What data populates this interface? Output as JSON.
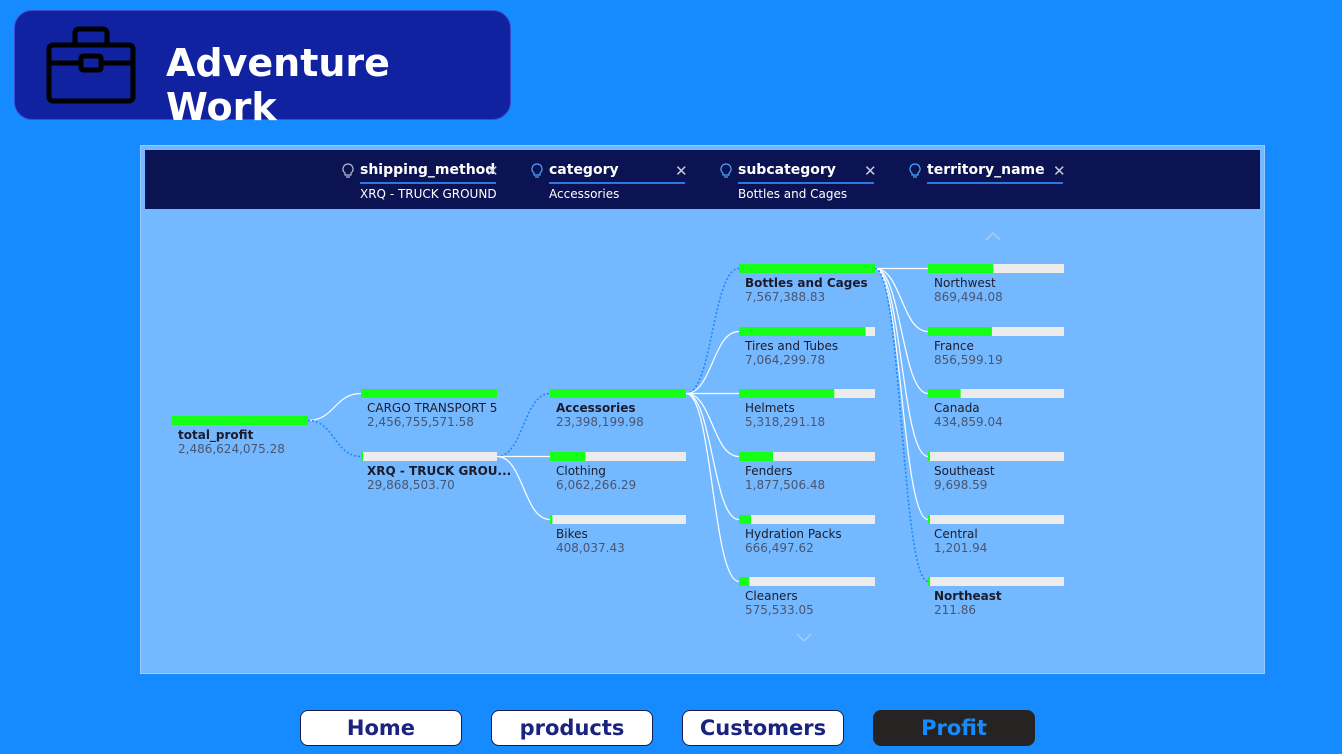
{
  "app": {
    "title": "Adventure Work"
  },
  "filters": [
    {
      "label": "shipping_method",
      "value": "XRQ - TRUCK GROUND"
    },
    {
      "label": "category",
      "value": "Accessories"
    },
    {
      "label": "subcategory",
      "value": "Bottles and Cages"
    },
    {
      "label": "territory_name",
      "value": ""
    }
  ],
  "tree": {
    "root": {
      "name": "total_profit",
      "value": "2,486,624,075.28",
      "fill": 1.0
    },
    "levels": [
      [
        {
          "name": "CARGO TRANSPORT 5",
          "value": "2,456,755,571.58",
          "fill": 1.0,
          "selected": false
        },
        {
          "name": "XRQ - TRUCK GROU...",
          "value": "29,868,503.70",
          "fill": 0.012,
          "selected": true
        }
      ],
      [
        {
          "name": "Accessories",
          "value": "23,398,199.98",
          "fill": 1.0,
          "selected": true
        },
        {
          "name": "Clothing",
          "value": "6,062,266.29",
          "fill": 0.26,
          "selected": false
        },
        {
          "name": "Bikes",
          "value": "408,037.43",
          "fill": 0.017,
          "selected": false
        }
      ],
      [
        {
          "name": "Bottles and Cages",
          "value": "7,567,388.83",
          "fill": 1.0,
          "selected": true
        },
        {
          "name": "Tires and Tubes",
          "value": "7,064,299.78",
          "fill": 0.93,
          "selected": false
        },
        {
          "name": "Helmets",
          "value": "5,318,291.18",
          "fill": 0.7,
          "selected": false
        },
        {
          "name": "Fenders",
          "value": "1,877,506.48",
          "fill": 0.25,
          "selected": false
        },
        {
          "name": "Hydration Packs",
          "value": "666,497.62",
          "fill": 0.088,
          "selected": false
        },
        {
          "name": "Cleaners",
          "value": "575,533.05",
          "fill": 0.076,
          "selected": false
        }
      ],
      [
        {
          "name": "Northwest",
          "value": "869,494.08",
          "fill": 0.48,
          "selected": false
        },
        {
          "name": "France",
          "value": "856,599.19",
          "fill": 0.47,
          "selected": false
        },
        {
          "name": "Canada",
          "value": "434,859.04",
          "fill": 0.24,
          "selected": false
        },
        {
          "name": "Southeast",
          "value": "9,698.59",
          "fill": 0.006,
          "selected": false
        },
        {
          "name": "Central",
          "value": "1,201.94",
          "fill": 0.001,
          "selected": false
        },
        {
          "name": "Northeast",
          "value": "211.86",
          "fill": 0.0,
          "selected": true
        }
      ]
    ]
  },
  "nav": [
    {
      "label": "Home",
      "active": false
    },
    {
      "label": "products",
      "active": false
    },
    {
      "label": "Customers",
      "active": false
    },
    {
      "label": "Profit",
      "active": true
    }
  ],
  "colors": {
    "background": "#168bff",
    "title_card": "#1122a0",
    "bar_fill": "#16ff16",
    "bar_track": "#ececec",
    "filter_header": "#0c1352",
    "active_nav": "#252423"
  }
}
